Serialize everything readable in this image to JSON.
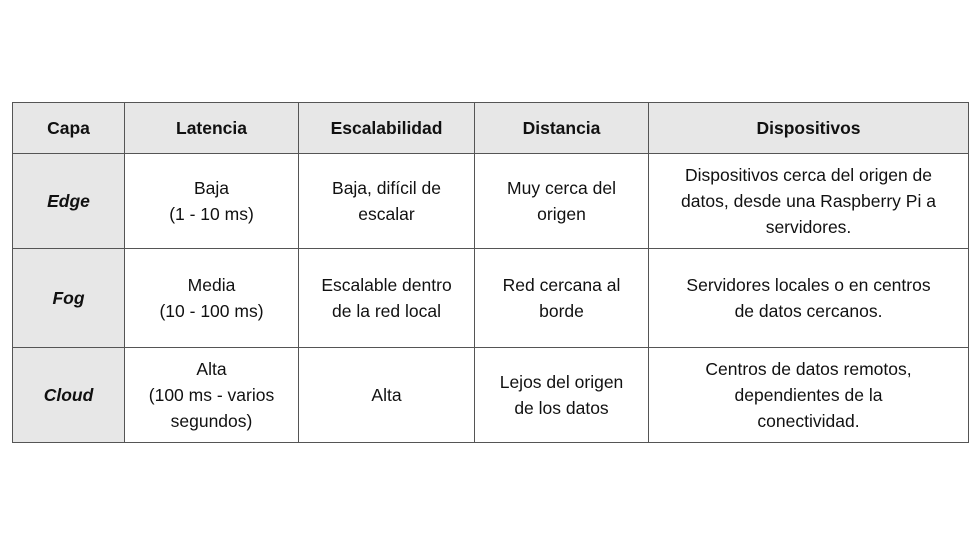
{
  "table": {
    "headers": [
      "Capa",
      "Latencia",
      "Escalabilidad",
      "Distancia",
      "Dispositivos"
    ],
    "rows": [
      {
        "layer": "Edge",
        "latency": [
          "Baja",
          "(1 - 10 ms)"
        ],
        "scalability": [
          "Baja, difícil de",
          "escalar"
        ],
        "distance": [
          "Muy cerca del",
          "origen"
        ],
        "devices": [
          "Dispositivos cerca del origen de",
          "datos, desde una Raspberry Pi a",
          "servidores."
        ]
      },
      {
        "layer": "Fog",
        "latency": [
          "Media",
          "(10 - 100 ms)"
        ],
        "scalability": [
          "Escalable dentro",
          "de la red local"
        ],
        "distance": [
          "Red cercana al",
          "borde"
        ],
        "devices": [
          "Servidores locales o en centros",
          "de datos cercanos."
        ]
      },
      {
        "layer": "Cloud",
        "latency": [
          "Alta",
          "(100 ms - varios",
          "segundos)"
        ],
        "scalability": [
          "Alta"
        ],
        "distance": [
          "Lejos del origen",
          "de los datos"
        ],
        "devices": [
          "Centros de datos remotos,",
          "dependientes de la",
          "conectividad."
        ]
      }
    ]
  }
}
